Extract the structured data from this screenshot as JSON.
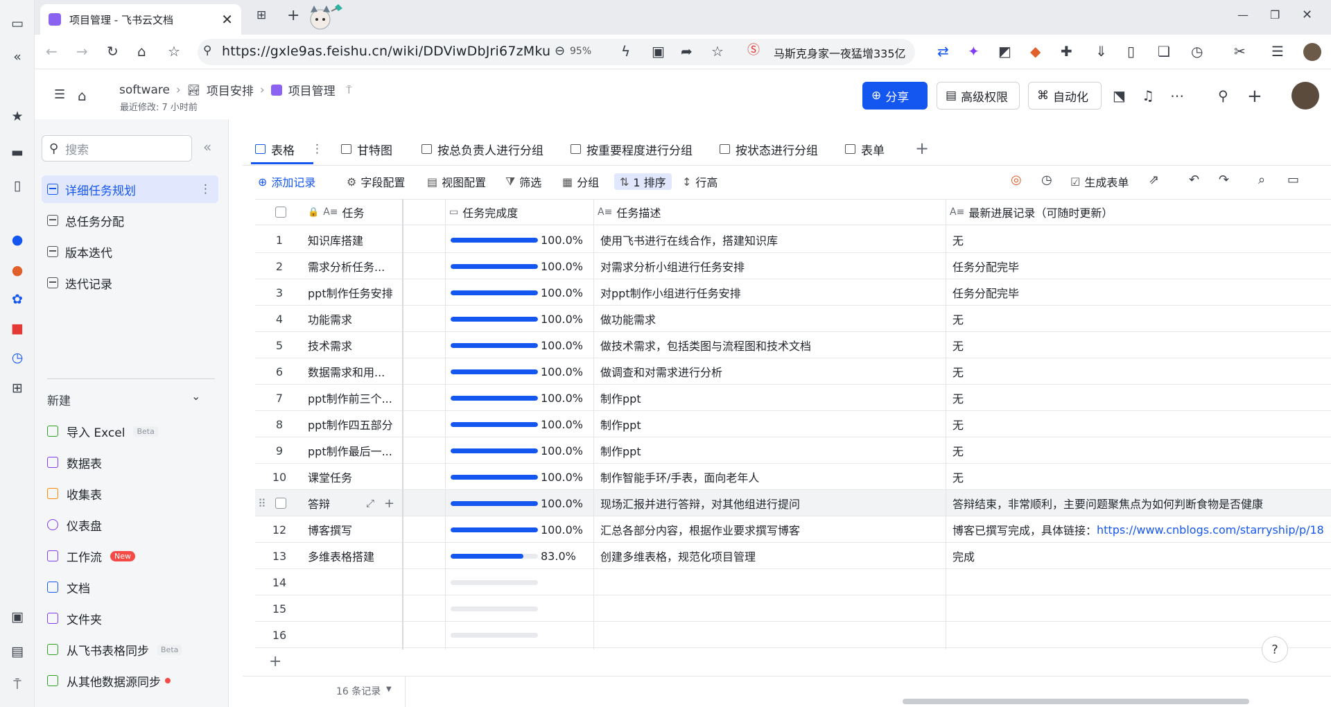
{
  "browser": {
    "tab_title": "项目管理 - 飞书云文档",
    "url": "https://gxle9as.feishu.cn/wiki/DDViwDbJri67zMku",
    "zoom": "95%",
    "news_text": "马斯克身家一夜猛增335亿"
  },
  "header": {
    "breadcrumb": [
      "software",
      "项目安排",
      "项目管理"
    ],
    "last_modified": "最近修改: 7 小时前",
    "share": "分享",
    "advanced_permission": "高级权限",
    "automation": "自动化"
  },
  "sidebar": {
    "search_placeholder": "搜索",
    "tables": [
      "详细任务规划",
      "总任务分配",
      "版本迭代",
      "迭代记录"
    ],
    "new_label": "新建",
    "new_items": [
      {
        "label": "导入 Excel",
        "badge": "Beta",
        "color": "#2ea121"
      },
      {
        "label": "数据表",
        "badge": "",
        "color": "#7f3bf5"
      },
      {
        "label": "收集表",
        "badge": "",
        "color": "#ff8800"
      },
      {
        "label": "仪表盘",
        "badge": "",
        "color": "#7f3bf5"
      },
      {
        "label": "工作流",
        "badge": "New",
        "color": "#7f3bf5"
      },
      {
        "label": "文档",
        "badge": "",
        "color": "#1456f0"
      },
      {
        "label": "文件夹",
        "badge": "",
        "color": "#7f3bf5"
      },
      {
        "label": "从飞书表格同步",
        "badge": "Beta",
        "color": "#2ea121"
      },
      {
        "label": "从其他数据源同步",
        "badge": "",
        "color": "#2ea121"
      }
    ]
  },
  "views": [
    "表格",
    "甘特图",
    "按总负责人进行分组",
    "按重要程度进行分组",
    "按状态进行分组",
    "表单"
  ],
  "toolbar": {
    "add_record": "添加记录",
    "field_config": "字段配置",
    "view_config": "视图配置",
    "filter": "筛选",
    "group": "分组",
    "sort": "1 排序",
    "row_height": "行高",
    "generate_form": "生成表单"
  },
  "columns": [
    "任务",
    "任务完成度",
    "任务描述",
    "最新进展记录（可随时更新）"
  ],
  "rows": [
    {
      "n": "1",
      "task": "知识库搭建",
      "progress": 1.0,
      "pct": "100.0%",
      "desc": "使用飞书进行在线合作，搭建知识库",
      "update": "无"
    },
    {
      "n": "2",
      "task": "需求分析任务...",
      "progress": 1.0,
      "pct": "100.0%",
      "desc": "对需求分析小组进行任务安排",
      "update": "任务分配完毕"
    },
    {
      "n": "3",
      "task": "ppt制作任务安排",
      "progress": 1.0,
      "pct": "100.0%",
      "desc": "对ppt制作小组进行任务安排",
      "update": "任务分配完毕"
    },
    {
      "n": "4",
      "task": "功能需求",
      "progress": 1.0,
      "pct": "100.0%",
      "desc": "做功能需求",
      "update": "无"
    },
    {
      "n": "5",
      "task": "技术需求",
      "progress": 1.0,
      "pct": "100.0%",
      "desc": "做技术需求，包括类图与流程图和技术文档",
      "update": "无"
    },
    {
      "n": "6",
      "task": "数据需求和用...",
      "progress": 1.0,
      "pct": "100.0%",
      "desc": "做调查和对需求进行分析",
      "update": "无"
    },
    {
      "n": "7",
      "task": "ppt制作前三个...",
      "progress": 1.0,
      "pct": "100.0%",
      "desc": "制作ppt",
      "update": "无"
    },
    {
      "n": "8",
      "task": "ppt制作四五部分",
      "progress": 1.0,
      "pct": "100.0%",
      "desc": "制作ppt",
      "update": "无"
    },
    {
      "n": "9",
      "task": "ppt制作最后一...",
      "progress": 1.0,
      "pct": "100.0%",
      "desc": "制作ppt",
      "update": "无"
    },
    {
      "n": "10",
      "task": "课堂任务",
      "progress": 1.0,
      "pct": "100.0%",
      "desc": "制作智能手环/手表，面向老年人",
      "update": "无"
    },
    {
      "n": "",
      "task": "答辩",
      "progress": 1.0,
      "pct": "100.0%",
      "desc": "现场汇报并进行答辩，对其他组进行提问",
      "update": "答辩结束，非常顺利，主要问题聚焦点为如何判断食物是否健康"
    },
    {
      "n": "12",
      "task": "博客撰写",
      "progress": 1.0,
      "pct": "100.0%",
      "desc": "汇总各部分内容，根据作业要求撰写博客",
      "update": "博客已撰写完成，具体链接：",
      "link": "https://www.cnblogs.com/starryship/p/18"
    },
    {
      "n": "13",
      "task": "多维表格搭建",
      "progress": 0.83,
      "pct": "83.0%",
      "desc": "创建多维表格，规范化项目管理",
      "update": "完成"
    },
    {
      "n": "14",
      "task": "",
      "progress": 0,
      "pct": "",
      "desc": "",
      "update": ""
    },
    {
      "n": "15",
      "task": "",
      "progress": 0,
      "pct": "",
      "desc": "",
      "update": ""
    },
    {
      "n": "16",
      "task": "",
      "progress": 0,
      "pct": "",
      "desc": "",
      "update": ""
    }
  ],
  "footer": {
    "record_count": "16 条记录"
  }
}
